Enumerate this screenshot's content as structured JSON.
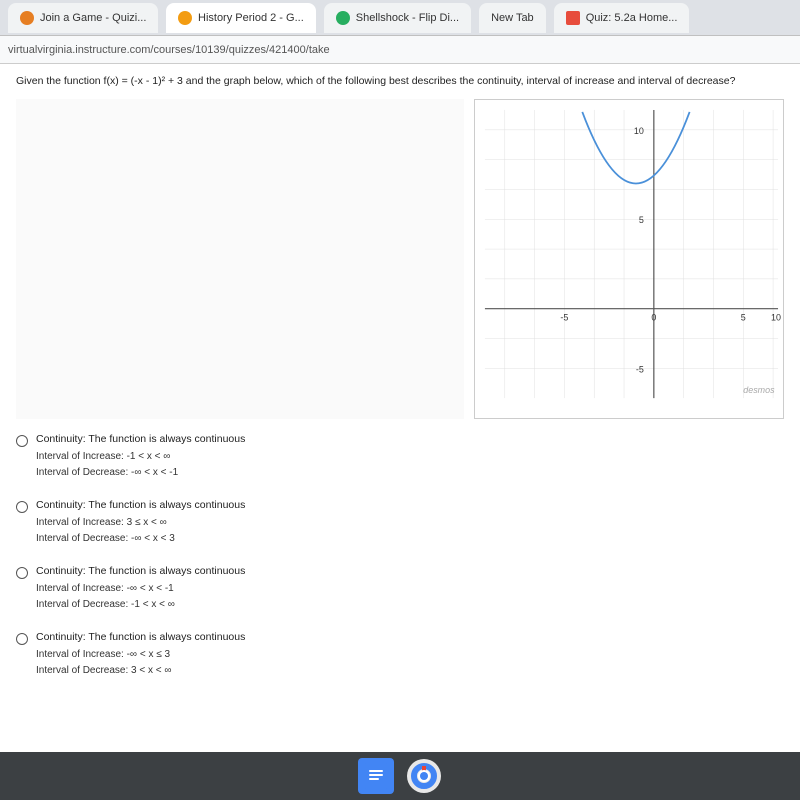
{
  "browser": {
    "url": "virtualvirginia.instructure.com/courses/10139/quizzes/421400/take",
    "tabs": [
      {
        "label": "Join a Game - Quizi...",
        "color": "#e67e22",
        "active": false
      },
      {
        "label": "History Period 2 - G...",
        "color": "#f39c12",
        "active": true
      },
      {
        "label": "Shellshock - Flip Di...",
        "color": "#27ae60",
        "active": false
      },
      {
        "label": "New Tab",
        "color": "#555",
        "active": false
      },
      {
        "label": "Quiz: 5.2a Home...",
        "color": "#e74c3c",
        "active": false
      }
    ]
  },
  "question": {
    "text": "Given the function f(x) = (-x - 1)² + 3 and the graph below, which of the following best describes the continuity, interval of increase and interval of decrease?"
  },
  "options": [
    {
      "id": "opt1",
      "main": "Continuity: The function is always continuous",
      "line1": "Interval of Increase: -1 < x < ∞",
      "line2": "Interval of Decrease: -∞ < x < -1"
    },
    {
      "id": "opt2",
      "main": "Continuity: The function is always continuous",
      "line1": "Interval of Increase: 3 ≤ x < ∞",
      "line2": "Interval of Decrease: -∞ < x < 3"
    },
    {
      "id": "opt3",
      "main": "Continuity: The function is always continuous",
      "line1": "Interval of Increase: -∞ < x < -1",
      "line2": "Interval of Decrease: -1 < x < ∞"
    },
    {
      "id": "opt4",
      "main": "Continuity: The function is always continuous",
      "line1": "Interval of Increase: -∞ < x ≤ 3",
      "line2": "Interval of Decrease: 3 < x < ∞"
    }
  ],
  "graph": {
    "x_labels": [
      "-5",
      "0",
      "5",
      "10"
    ],
    "y_labels": [
      "10",
      "5",
      "-5"
    ],
    "watermark": "desmos"
  },
  "taskbar": {
    "docs_label": "Google Docs",
    "chrome_label": "Google Chrome"
  }
}
